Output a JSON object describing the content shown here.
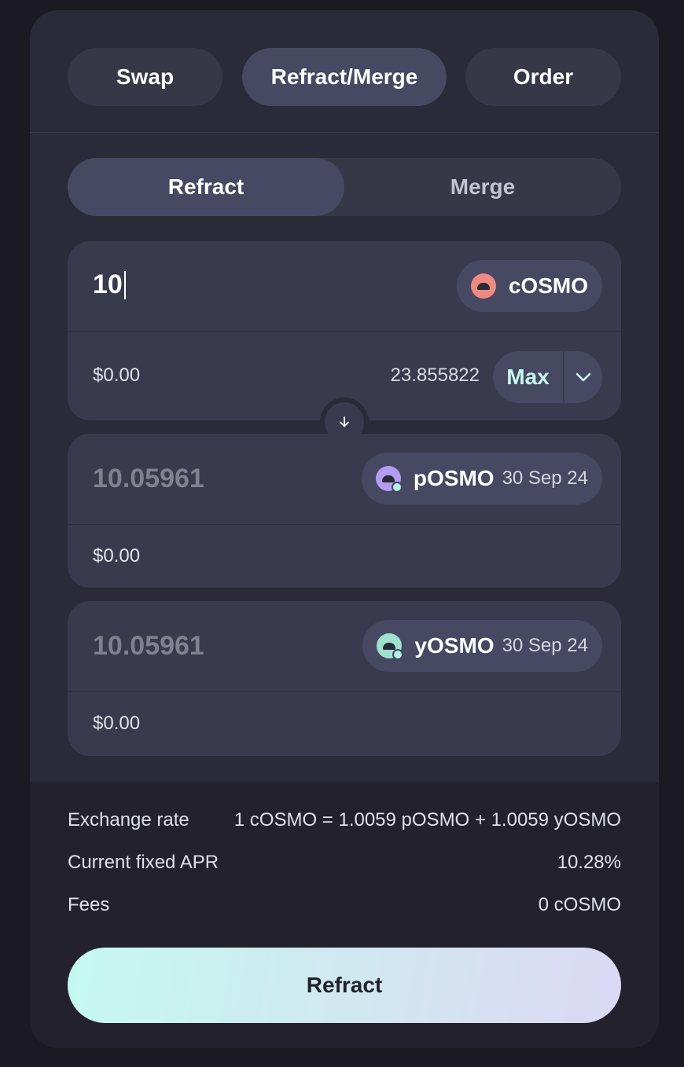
{
  "tabs": [
    "Swap",
    "Refract/Merge",
    "Order"
  ],
  "mode": {
    "refract": "Refract",
    "merge": "Merge"
  },
  "input": {
    "amount": "10",
    "token": "cOSMO",
    "usd": "$0.00",
    "balance": "23.855822",
    "max_label": "Max"
  },
  "output_p": {
    "amount": "10.05961",
    "token": "pOSMO",
    "date": "30 Sep 24",
    "usd": "$0.00"
  },
  "output_y": {
    "amount": "10.05961",
    "token": "yOSMO",
    "date": "30 Sep 24",
    "usd": "$0.00"
  },
  "details": {
    "exchange_rate_label": "Exchange rate",
    "exchange_rate_value": "1 cOSMO = 1.0059 pOSMO + 1.0059 yOSMO",
    "apr_label": "Current fixed APR",
    "apr_value": "10.28%",
    "fees_label": "Fees",
    "fees_value": "0 cOSMO"
  },
  "action_label": "Refract",
  "colors": {
    "cosmo_icon": "#ef8a82",
    "posmo_icon": "#b59cf2",
    "yosmo_icon": "#9fe2cf",
    "accent": "#c4f9ee"
  }
}
